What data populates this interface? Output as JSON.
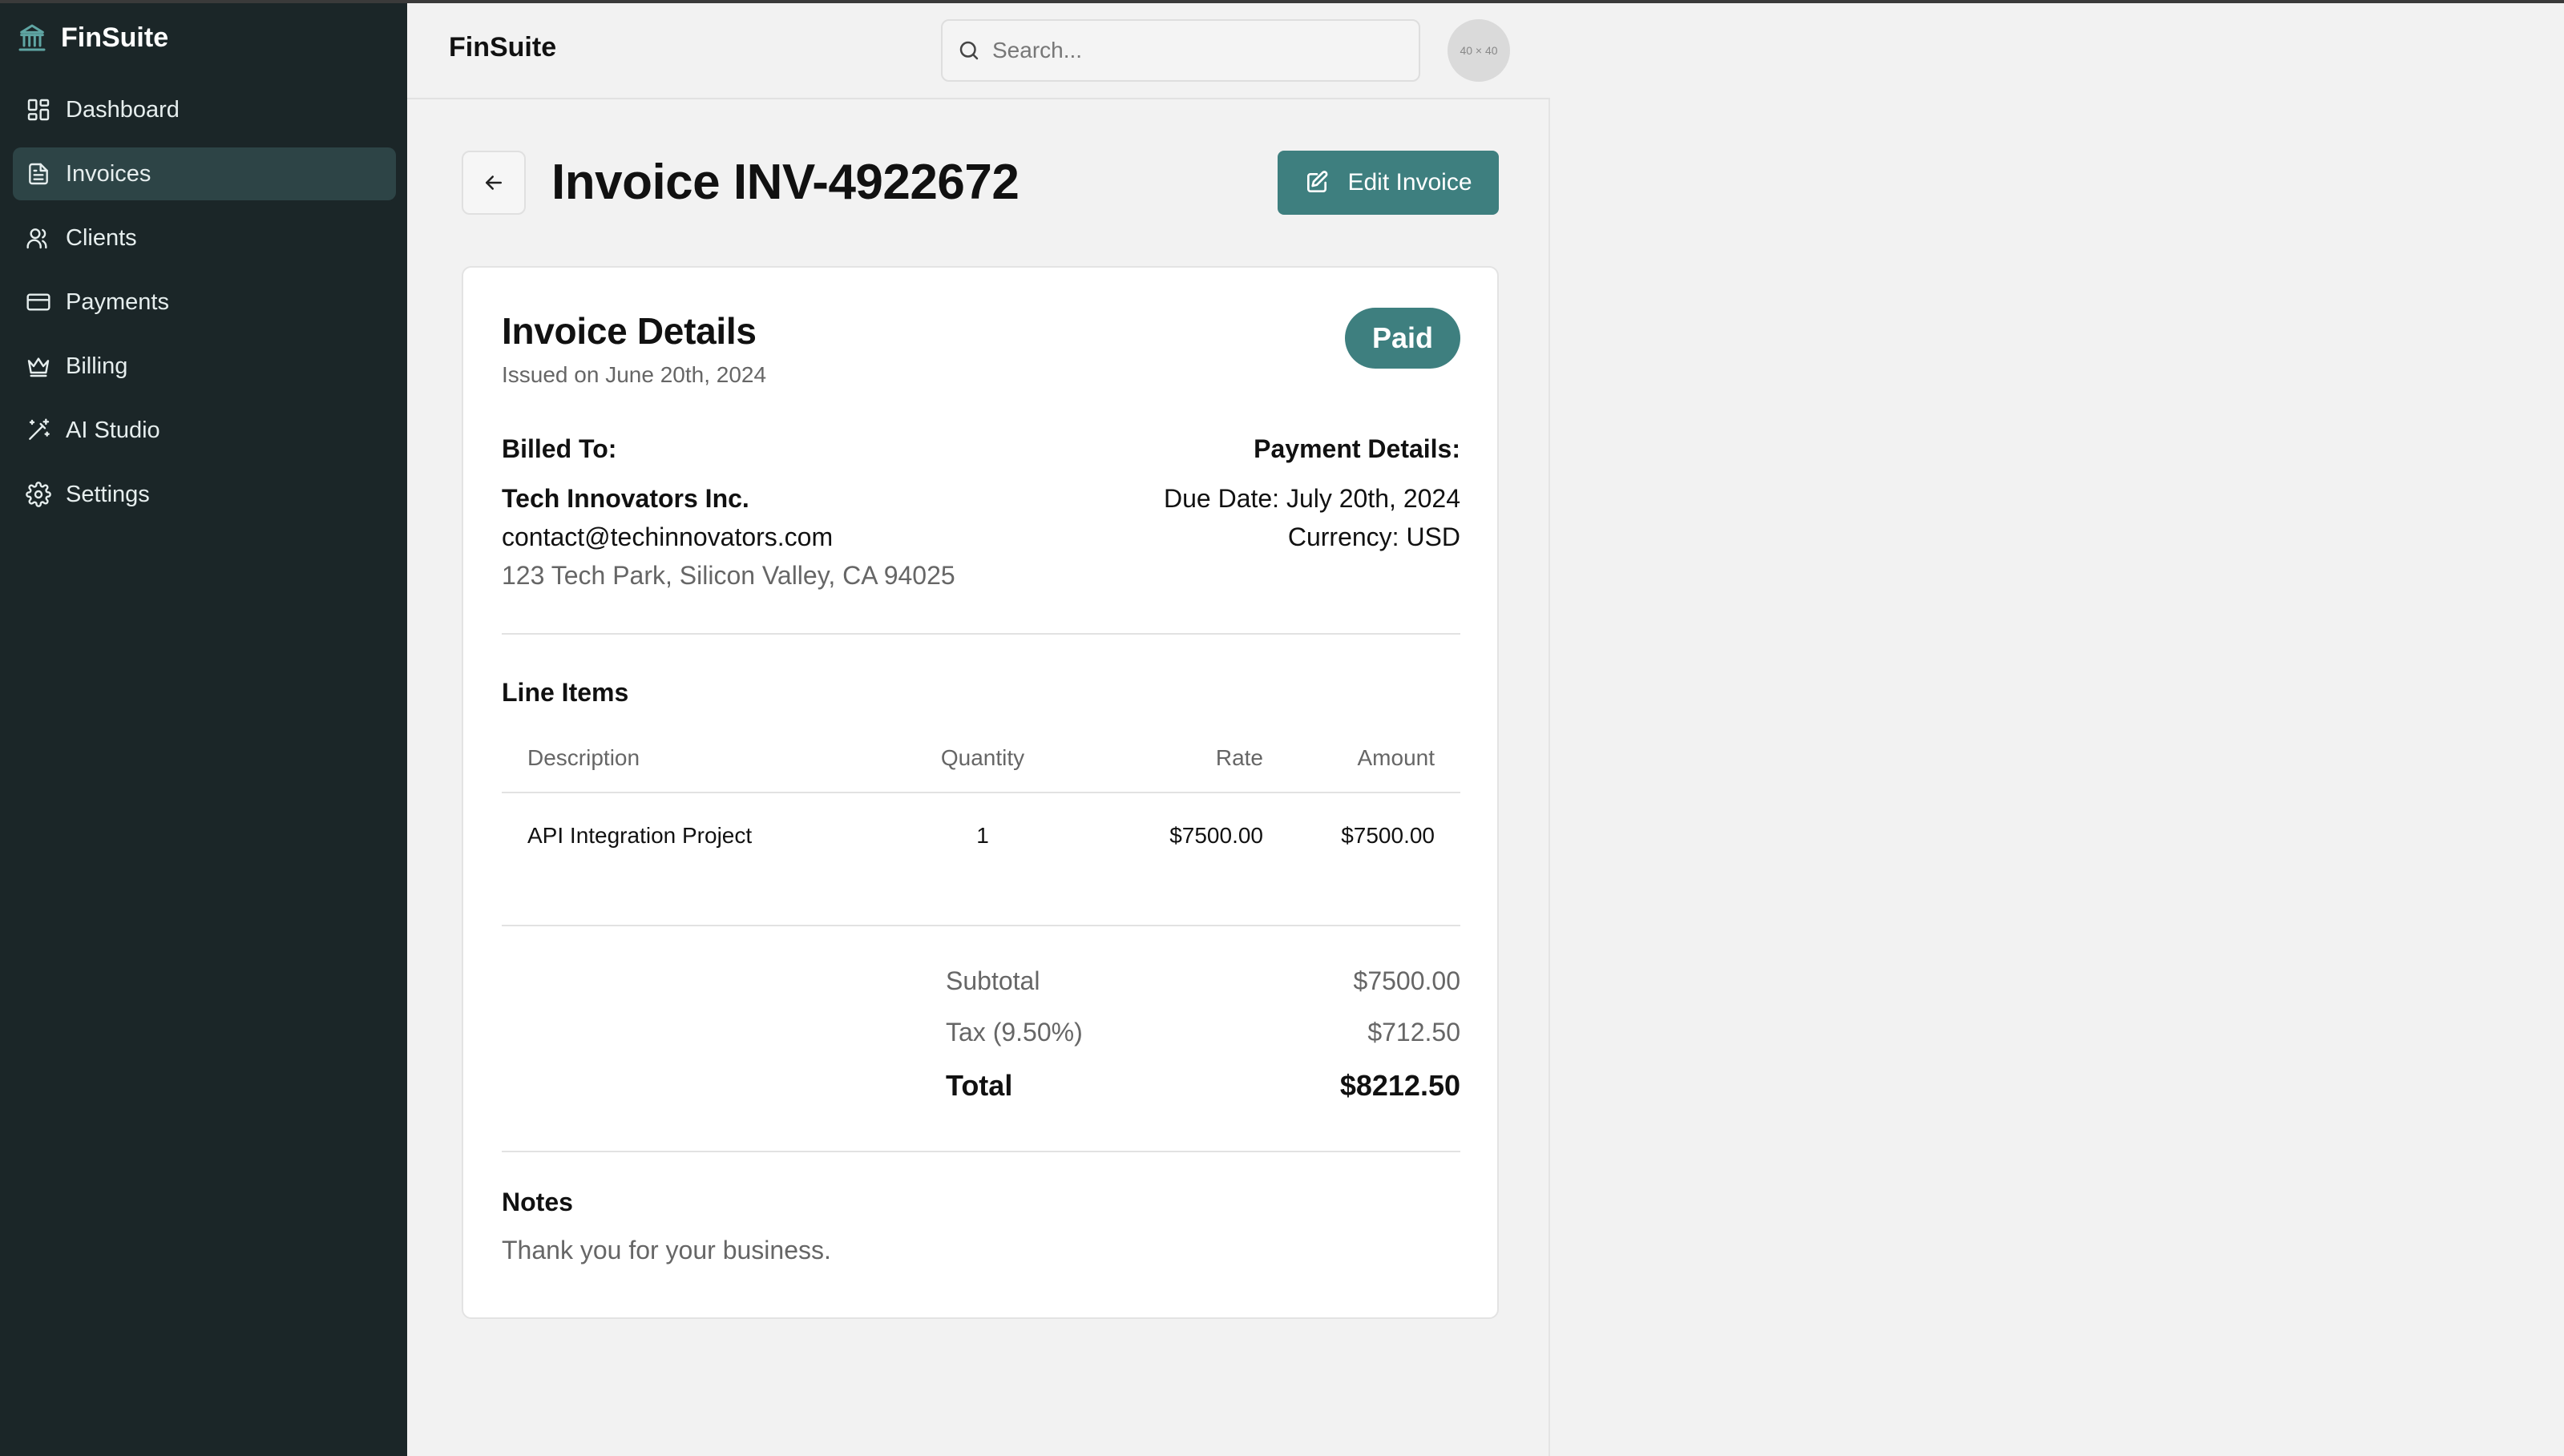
{
  "app": {
    "name": "FinSuite"
  },
  "sidebar": {
    "items": [
      {
        "label": "Dashboard",
        "icon": "dashboard-icon",
        "active": false
      },
      {
        "label": "Invoices",
        "icon": "document-icon",
        "active": true
      },
      {
        "label": "Clients",
        "icon": "users-icon",
        "active": false
      },
      {
        "label": "Payments",
        "icon": "credit-card-icon",
        "active": false
      },
      {
        "label": "Billing",
        "icon": "crown-icon",
        "active": false
      },
      {
        "label": "AI Studio",
        "icon": "magic-wand-icon",
        "active": false
      },
      {
        "label": "Settings",
        "icon": "gear-icon",
        "active": false
      }
    ]
  },
  "header": {
    "title": "FinSuite",
    "search_placeholder": "Search...",
    "avatar_text": "40 × 40"
  },
  "page": {
    "title": "Invoice INV-4922672",
    "edit_label": "Edit Invoice"
  },
  "invoice": {
    "details_title": "Invoice Details",
    "issued": "Issued on June 20th, 2024",
    "status": "Paid",
    "billed_label": "Billed To:",
    "client_name": "Tech Innovators Inc.",
    "client_email": "contact@techinnovators.com",
    "client_address": "123 Tech Park, Silicon Valley, CA 94025",
    "payment_label": "Payment Details:",
    "due_date": "Due Date: July 20th, 2024",
    "currency": "Currency: USD",
    "line_items_title": "Line Items",
    "columns": [
      "Description",
      "Quantity",
      "Rate",
      "Amount"
    ],
    "rows": [
      {
        "description": "API Integration Project",
        "quantity": "1",
        "rate": "$7500.00",
        "amount": "$7500.00"
      }
    ],
    "subtotal_label": "Subtotal",
    "subtotal": "$7500.00",
    "tax_label": "Tax (9.50%)",
    "tax": "$712.50",
    "total_label": "Total",
    "total": "$8212.50",
    "notes_title": "Notes",
    "notes": "Thank you for your business."
  },
  "colors": {
    "sidebar_bg": "#1b2628",
    "sidebar_active": "#2d4446",
    "accent": "#3e7f7f"
  }
}
